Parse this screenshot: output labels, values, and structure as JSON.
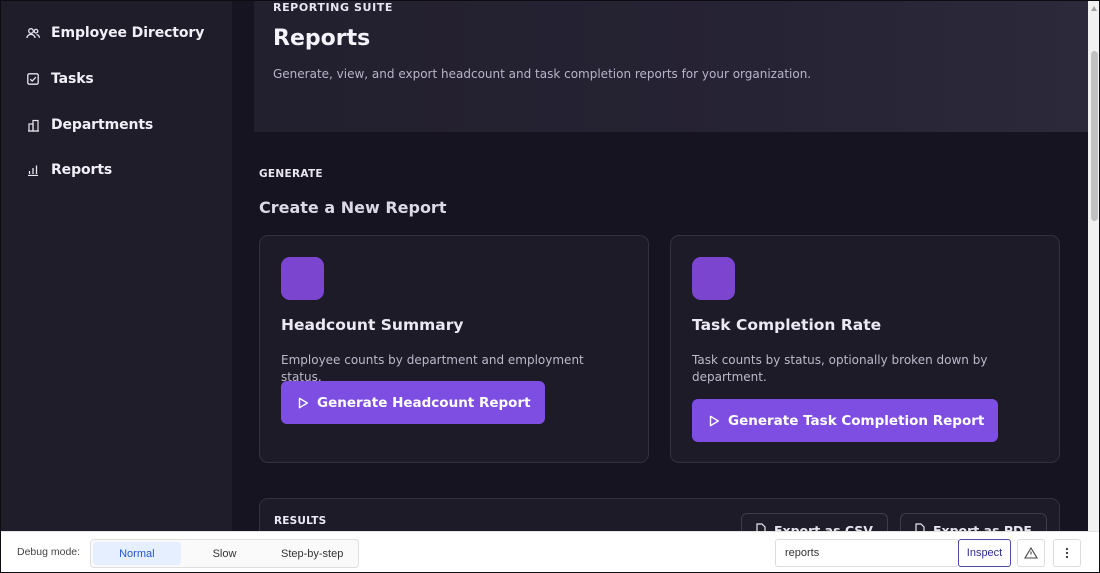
{
  "sidebar": {
    "items": [
      {
        "label": "Employee Directory",
        "icon": "users-icon"
      },
      {
        "label": "Tasks",
        "icon": "checkbox-icon"
      },
      {
        "label": "Departments",
        "icon": "building-icon"
      },
      {
        "label": "Reports",
        "icon": "bar-chart-icon"
      }
    ]
  },
  "header": {
    "eyebrow": "REPORTING SUITE",
    "title": "Reports",
    "description": "Generate, view, and export headcount and task completion reports for your organization."
  },
  "generate": {
    "section_label": "GENERATE",
    "section_title": "Create a New Report",
    "cards": [
      {
        "title": "Headcount Summary",
        "description": "Employee counts by department and employment status.",
        "button_label": "Generate Headcount Report"
      },
      {
        "title": "Task Completion Rate",
        "description": "Task counts by status, optionally broken down by department.",
        "button_label": "Generate Task Completion Report"
      }
    ]
  },
  "results": {
    "label": "RESULTS",
    "export_csv_label": "Export as CSV",
    "export_pdf_label": "Export as PDF"
  },
  "debug": {
    "label": "Debug mode:",
    "modes": [
      "Normal",
      "Slow",
      "Step-by-step"
    ],
    "active_mode": "Normal",
    "route_value": "reports",
    "inspect_label": "Inspect"
  },
  "colors": {
    "accent": "#7e4ee3",
    "card_chip": "#7b45cf",
    "sidebar_bg": "#1f1d29",
    "main_bg": "#161420"
  }
}
